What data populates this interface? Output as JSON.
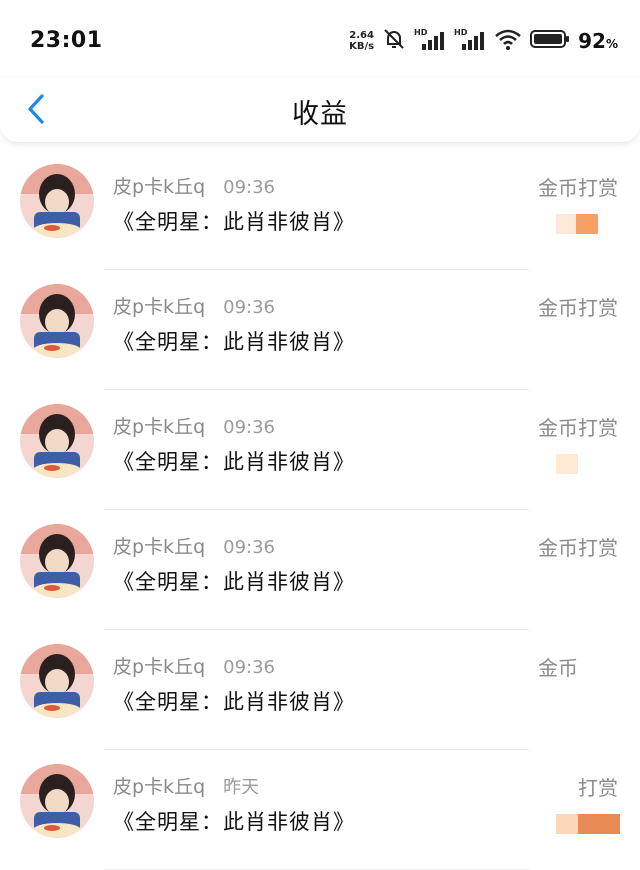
{
  "status_bar": {
    "time": "23:01",
    "net_speed_value": "2.64",
    "net_speed_unit": "KB/s",
    "battery_percent": "92",
    "battery_unit": "%"
  },
  "header": {
    "title": "收益",
    "back_icon": "chevron-left-icon"
  },
  "colors": {
    "accent": "#1e88e5",
    "blur_light": "#fde5d0",
    "blur_dark": "#f08a4b"
  },
  "rows": [
    {
      "username": "皮p卡k丘q",
      "time": "09:36",
      "work": "《全明星：此肖非彼肖》",
      "reward_label": "金币打赏"
    },
    {
      "username": "皮p卡k丘q",
      "time": "09:36",
      "work": "《全明星：此肖非彼肖》",
      "reward_label": "金币打赏"
    },
    {
      "username": "皮p卡k丘q",
      "time": "09:36",
      "work": "《全明星：此肖非彼肖》",
      "reward_label": "金币打赏"
    },
    {
      "username": "皮p卡k丘q",
      "time": "09:36",
      "work": "《全明星：此肖非彼肖》",
      "reward_label": "金币打赏"
    },
    {
      "username": "皮p卡k丘q",
      "time": "09:36",
      "work": "《全明星：此肖非彼肖》",
      "reward_label": "金币"
    },
    {
      "username": "皮p卡k丘q",
      "time": "昨天",
      "work": "《全明星：此肖非彼肖》",
      "reward_label": "打赏"
    }
  ]
}
